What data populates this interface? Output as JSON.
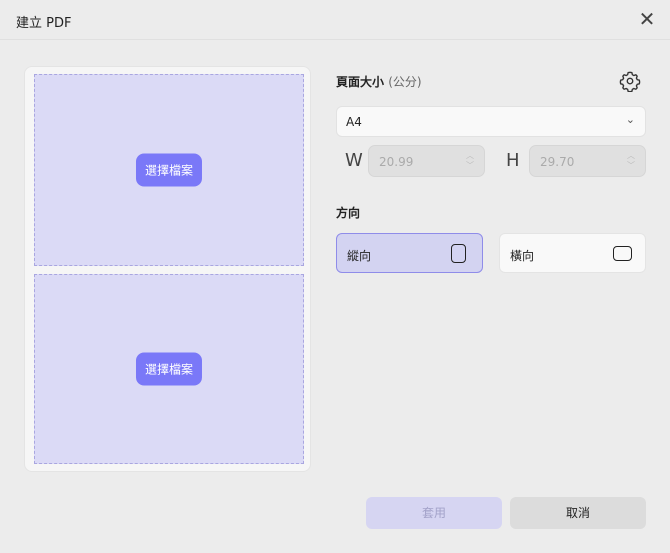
{
  "window": {
    "title": "建立 PDF",
    "close_icon": "close-icon"
  },
  "preview": {
    "slots": [
      {
        "button": "選擇檔案"
      },
      {
        "button": "選擇檔案"
      }
    ]
  },
  "page_size": {
    "label": "頁面大小",
    "unit": "(公分)",
    "selected": "A4",
    "width_label": "W",
    "width": "20.99",
    "height_label": "H",
    "height": "29.70"
  },
  "orientation": {
    "label": "方向",
    "portrait": "縱向",
    "landscape": "橫向",
    "selected": "portrait"
  },
  "footer": {
    "apply": "套用",
    "cancel": "取消"
  }
}
